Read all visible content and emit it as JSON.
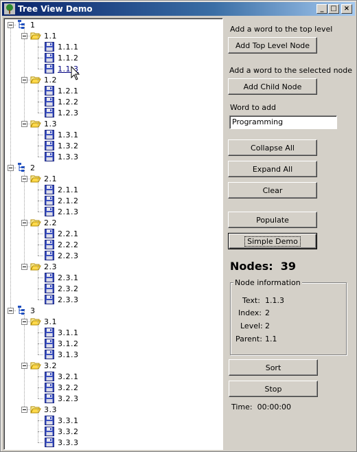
{
  "window": {
    "title": "Tree View Demo",
    "buttons": {
      "minimize": "_",
      "maximize": "□",
      "close": "×"
    }
  },
  "tree": {
    "roots": [
      {
        "label": "1",
        "children": [
          {
            "label": "1.1",
            "children": [
              "1.1.1",
              "1.1.2",
              "1.1.3"
            ]
          },
          {
            "label": "1.2",
            "children": [
              "1.2.1",
              "1.2.2",
              "1.2.3"
            ]
          },
          {
            "label": "1.3",
            "children": [
              "1.3.1",
              "1.3.2",
              "1.3.3"
            ]
          }
        ]
      },
      {
        "label": "2",
        "children": [
          {
            "label": "2.1",
            "children": [
              "2.1.1",
              "2.1.2",
              "2.1.3"
            ]
          },
          {
            "label": "2.2",
            "children": [
              "2.2.1",
              "2.2.2",
              "2.2.3"
            ]
          },
          {
            "label": "2.3",
            "children": [
              "2.3.1",
              "2.3.2",
              "2.3.3"
            ]
          }
        ]
      },
      {
        "label": "3",
        "children": [
          {
            "label": "3.1",
            "children": [
              "3.1.1",
              "3.1.2",
              "3.1.3"
            ]
          },
          {
            "label": "3.2",
            "children": [
              "3.2.1",
              "3.2.2",
              "3.2.3"
            ]
          },
          {
            "label": "3.3",
            "children": [
              "3.3.1",
              "3.3.2",
              "3.3.3"
            ]
          }
        ]
      }
    ],
    "hovered_node": "1.1.3",
    "icons": {
      "root": "tree-root-icon",
      "folder": "open-folder-icon",
      "leaf": "floppy-disk-icon"
    }
  },
  "panel": {
    "top_level_caption": "Add a word to the top level",
    "add_top_level_button": "Add Top Level Node",
    "selected_caption": "Add a word to the selected node",
    "add_child_button": "Add Child Node",
    "word_caption": "Word to add",
    "word_value": "Programming",
    "collapse_button": "Collapse All",
    "expand_button": "Expand All",
    "clear_button": "Clear",
    "populate_button": "Populate",
    "simple_demo_button": "Simple Demo",
    "nodes_label": "Nodes:",
    "nodes_count": "39",
    "node_info": {
      "title": "Node information",
      "text_label": "Text:",
      "text_value": "1.1.3",
      "index_label": "Index:",
      "index_value": "2",
      "level_label": "Level:",
      "level_value": "2",
      "parent_label": "Parent:",
      "parent_value": "1.1"
    },
    "sort_button": "Sort",
    "stop_button": "Stop",
    "time_label": "Time:",
    "time_value": "00:00:00"
  }
}
